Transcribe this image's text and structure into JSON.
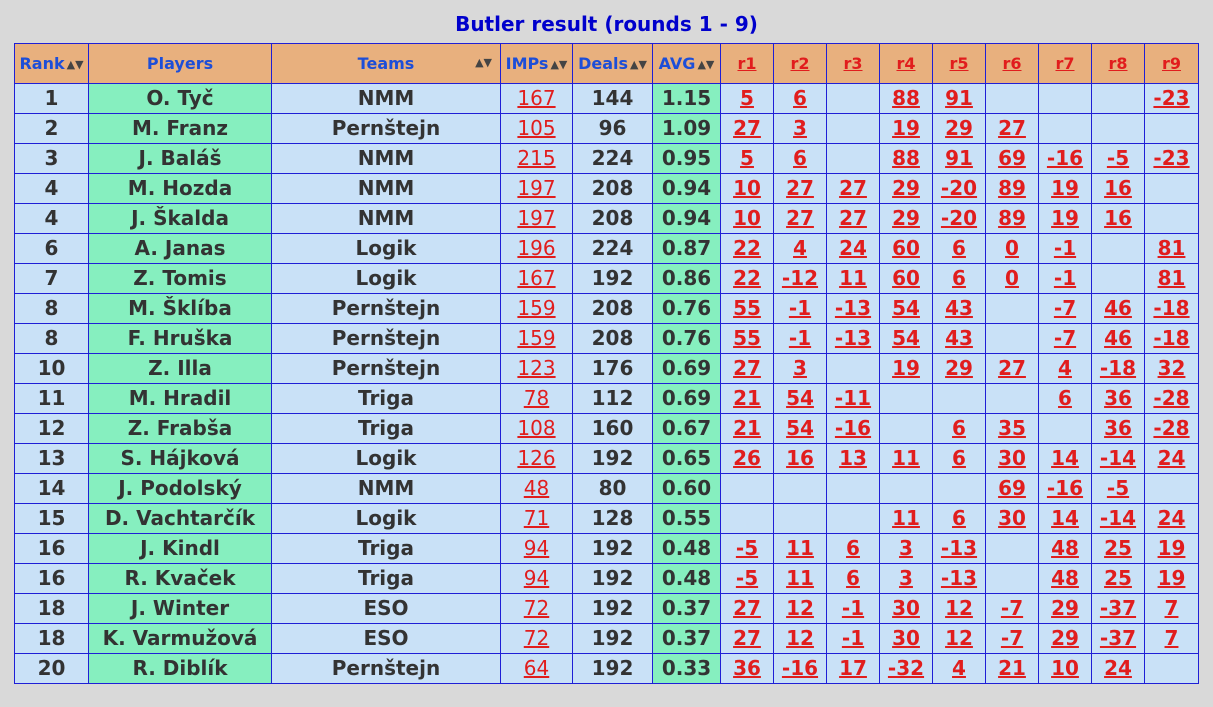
{
  "title": "Butler result (rounds 1 - 9)",
  "columns": {
    "rank": "Rank",
    "players": "Players",
    "teams": "Teams",
    "imps": "IMPs",
    "deals": "Deals",
    "avg": "AVG",
    "rounds": [
      "r1",
      "r2",
      "r3",
      "r4",
      "r5",
      "r6",
      "r7",
      "r8",
      "r9"
    ]
  },
  "rows": [
    {
      "rank": "1",
      "player": "O. Tyč",
      "team": "NMM",
      "imps": "167",
      "deals": "144",
      "avg": "1.15",
      "r": [
        "5",
        "6",
        "",
        "88",
        "91",
        "",
        "",
        "",
        "-23"
      ]
    },
    {
      "rank": "2",
      "player": "M. Franz",
      "team": "Pernštejn",
      "imps": "105",
      "deals": "96",
      "avg": "1.09",
      "r": [
        "27",
        "3",
        "",
        "19",
        "29",
        "27",
        "",
        "",
        ""
      ]
    },
    {
      "rank": "3",
      "player": "J. Baláš",
      "team": "NMM",
      "imps": "215",
      "deals": "224",
      "avg": "0.95",
      "r": [
        "5",
        "6",
        "",
        "88",
        "91",
        "69",
        "-16",
        "-5",
        "-23"
      ]
    },
    {
      "rank": "4",
      "player": "M. Hozda",
      "team": "NMM",
      "imps": "197",
      "deals": "208",
      "avg": "0.94",
      "r": [
        "10",
        "27",
        "27",
        "29",
        "-20",
        "89",
        "19",
        "16",
        ""
      ]
    },
    {
      "rank": "4",
      "player": "J. Škalda",
      "team": "NMM",
      "imps": "197",
      "deals": "208",
      "avg": "0.94",
      "r": [
        "10",
        "27",
        "27",
        "29",
        "-20",
        "89",
        "19",
        "16",
        ""
      ]
    },
    {
      "rank": "6",
      "player": "A. Janas",
      "team": "Logik",
      "imps": "196",
      "deals": "224",
      "avg": "0.87",
      "r": [
        "22",
        "4",
        "24",
        "60",
        "6",
        "0",
        "-1",
        "",
        "81"
      ]
    },
    {
      "rank": "7",
      "player": "Z. Tomis",
      "team": "Logik",
      "imps": "167",
      "deals": "192",
      "avg": "0.86",
      "r": [
        "22",
        "-12",
        "11",
        "60",
        "6",
        "0",
        "-1",
        "",
        "81"
      ]
    },
    {
      "rank": "8",
      "player": "M. Šklíba",
      "team": "Pernštejn",
      "imps": "159",
      "deals": "208",
      "avg": "0.76",
      "r": [
        "55",
        "-1",
        "-13",
        "54",
        "43",
        "",
        "-7",
        "46",
        "-18"
      ]
    },
    {
      "rank": "8",
      "player": "F. Hruška",
      "team": "Pernštejn",
      "imps": "159",
      "deals": "208",
      "avg": "0.76",
      "r": [
        "55",
        "-1",
        "-13",
        "54",
        "43",
        "",
        "-7",
        "46",
        "-18"
      ]
    },
    {
      "rank": "10",
      "player": "Z. Illa",
      "team": "Pernštejn",
      "imps": "123",
      "deals": "176",
      "avg": "0.69",
      "r": [
        "27",
        "3",
        "",
        "19",
        "29",
        "27",
        "4",
        "-18",
        "32"
      ]
    },
    {
      "rank": "11",
      "player": "M. Hradil",
      "team": "Triga",
      "imps": "78",
      "deals": "112",
      "avg": "0.69",
      "r": [
        "21",
        "54",
        "-11",
        "",
        "",
        "",
        "6",
        "36",
        "-28"
      ]
    },
    {
      "rank": "12",
      "player": "Z. Frabša",
      "team": "Triga",
      "imps": "108",
      "deals": "160",
      "avg": "0.67",
      "r": [
        "21",
        "54",
        "-16",
        "",
        "6",
        "35",
        "",
        "36",
        "-28"
      ]
    },
    {
      "rank": "13",
      "player": "S. Hájková",
      "team": "Logik",
      "imps": "126",
      "deals": "192",
      "avg": "0.65",
      "r": [
        "26",
        "16",
        "13",
        "11",
        "6",
        "30",
        "14",
        "-14",
        "24"
      ]
    },
    {
      "rank": "14",
      "player": "J. Podolský",
      "team": "NMM",
      "imps": "48",
      "deals": "80",
      "avg": "0.60",
      "r": [
        "",
        "",
        "",
        "",
        "",
        "69",
        "-16",
        "-5",
        ""
      ]
    },
    {
      "rank": "15",
      "player": "D. Vachtarčík",
      "team": "Logik",
      "imps": "71",
      "deals": "128",
      "avg": "0.55",
      "r": [
        "",
        "",
        "",
        "11",
        "6",
        "30",
        "14",
        "-14",
        "24"
      ]
    },
    {
      "rank": "16",
      "player": "J. Kindl",
      "team": "Triga",
      "imps": "94",
      "deals": "192",
      "avg": "0.48",
      "r": [
        "-5",
        "11",
        "6",
        "3",
        "-13",
        "",
        "48",
        "25",
        "19"
      ]
    },
    {
      "rank": "16",
      "player": "R. Kvaček",
      "team": "Triga",
      "imps": "94",
      "deals": "192",
      "avg": "0.48",
      "r": [
        "-5",
        "11",
        "6",
        "3",
        "-13",
        "",
        "48",
        "25",
        "19"
      ]
    },
    {
      "rank": "18",
      "player": "J. Winter",
      "team": "ESO",
      "imps": "72",
      "deals": "192",
      "avg": "0.37",
      "r": [
        "27",
        "12",
        "-1",
        "30",
        "12",
        "-7",
        "29",
        "-37",
        "7"
      ]
    },
    {
      "rank": "18",
      "player": "K. Varmužová",
      "team": "ESO",
      "imps": "72",
      "deals": "192",
      "avg": "0.37",
      "r": [
        "27",
        "12",
        "-1",
        "30",
        "12",
        "-7",
        "29",
        "-37",
        "7"
      ]
    },
    {
      "rank": "20",
      "player": "R. Diblík",
      "team": "Pernštejn",
      "imps": "64",
      "deals": "192",
      "avg": "0.33",
      "r": [
        "36",
        "-16",
        "17",
        "-32",
        "4",
        "21",
        "10",
        "24",
        ""
      ]
    }
  ]
}
